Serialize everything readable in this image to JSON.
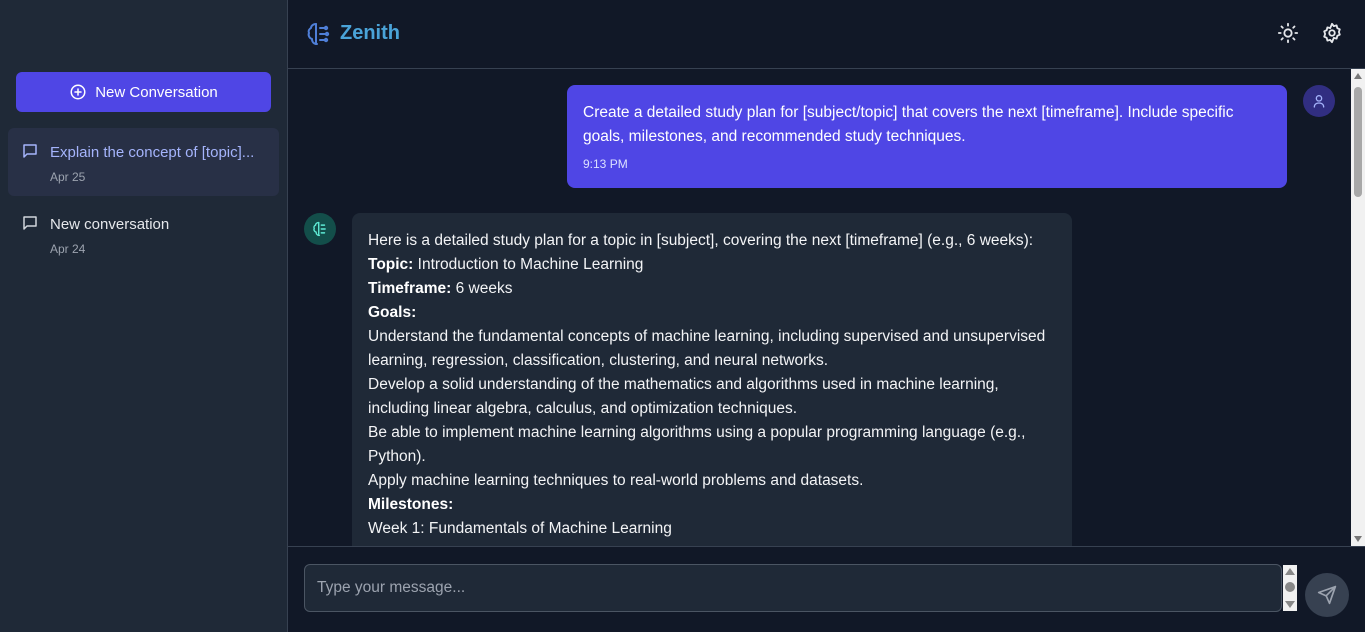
{
  "app": {
    "name": "Zenith",
    "accent": "#4f46e5"
  },
  "sidebar": {
    "new_button_label": "New Conversation",
    "conversations": [
      {
        "title": "Explain the concept of [topic]...",
        "date": "Apr 25",
        "active": true
      },
      {
        "title": "New conversation",
        "date": "Apr 24",
        "active": false
      }
    ]
  },
  "header": {
    "theme_icon": "sun-icon",
    "settings_icon": "gear-icon"
  },
  "messages": {
    "user": {
      "text": "Create a detailed study plan for [subject/topic] that covers the next [timeframe]. Include specific goals, milestones, and recommended study techniques.",
      "time": "9:13 PM"
    },
    "assistant": {
      "intro": "Here is a detailed study plan for a topic in [subject], covering the next [timeframe] (e.g., 6 weeks):",
      "topic_label": "Topic:",
      "topic_value": " Introduction to Machine Learning",
      "timeframe_label": "Timeframe:",
      "timeframe_value": " 6 weeks",
      "goals_label": "Goals:",
      "goals": [
        "Understand the fundamental concepts of machine learning, including supervised and unsupervised learning, regression, classification, clustering, and neural networks.",
        "Develop a solid understanding of the mathematics and algorithms used in machine learning, including linear algebra, calculus, and optimization techniques.",
        "Be able to implement machine learning algorithms using a popular programming language (e.g., Python).",
        "Apply machine learning techniques to real-world problems and datasets."
      ],
      "milestones_label": "Milestones:",
      "milestones": [
        "Week 1: Fundamentals of Machine Learning"
      ]
    }
  },
  "composer": {
    "placeholder": "Type your message..."
  }
}
